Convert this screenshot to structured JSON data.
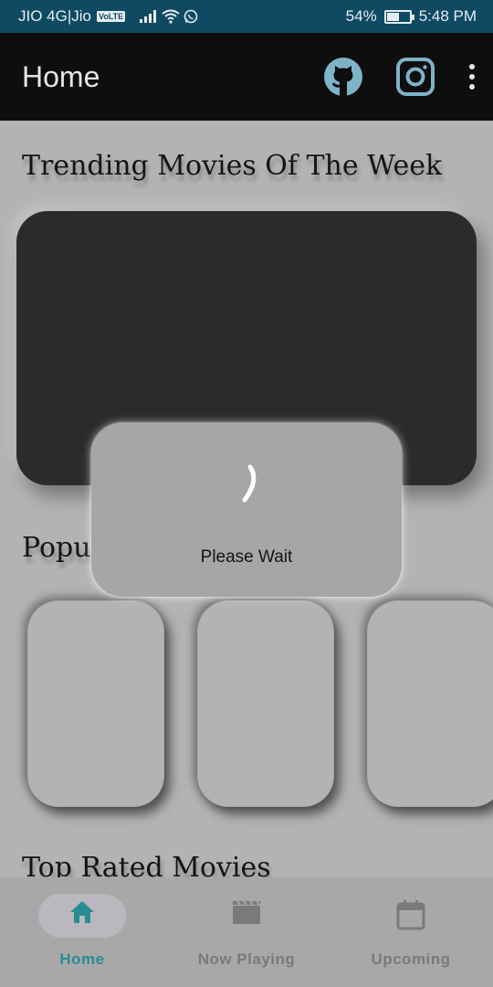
{
  "status_bar": {
    "carrier": "JIO 4G|Jio",
    "volte": "VoLTE",
    "battery_percent": "54%",
    "battery_level": 0.54,
    "time": "5:48 PM"
  },
  "app_bar": {
    "title": "Home",
    "icons": [
      "github-icon",
      "instagram-icon",
      "more-vert-icon"
    ]
  },
  "sections": {
    "trending_title": "Trending Movies Of The Week",
    "popular_title": "Popu",
    "top_rated_title": "Top Rated Movies"
  },
  "dialog": {
    "message": "Please Wait"
  },
  "bottom_nav": {
    "items": [
      {
        "label": "Home",
        "icon": "home-icon",
        "active": true
      },
      {
        "label": "Now Playing",
        "icon": "movie-clapper-icon",
        "active": false
      },
      {
        "label": "Upcoming",
        "icon": "calendar-icon",
        "active": false
      }
    ]
  },
  "colors": {
    "status_bar": "#0f4a63",
    "app_bar": "#0e0e0e",
    "overlay_background": "#b3b3b3",
    "accent": "#2a8c93",
    "icon_tint": "#7fb3c8"
  }
}
